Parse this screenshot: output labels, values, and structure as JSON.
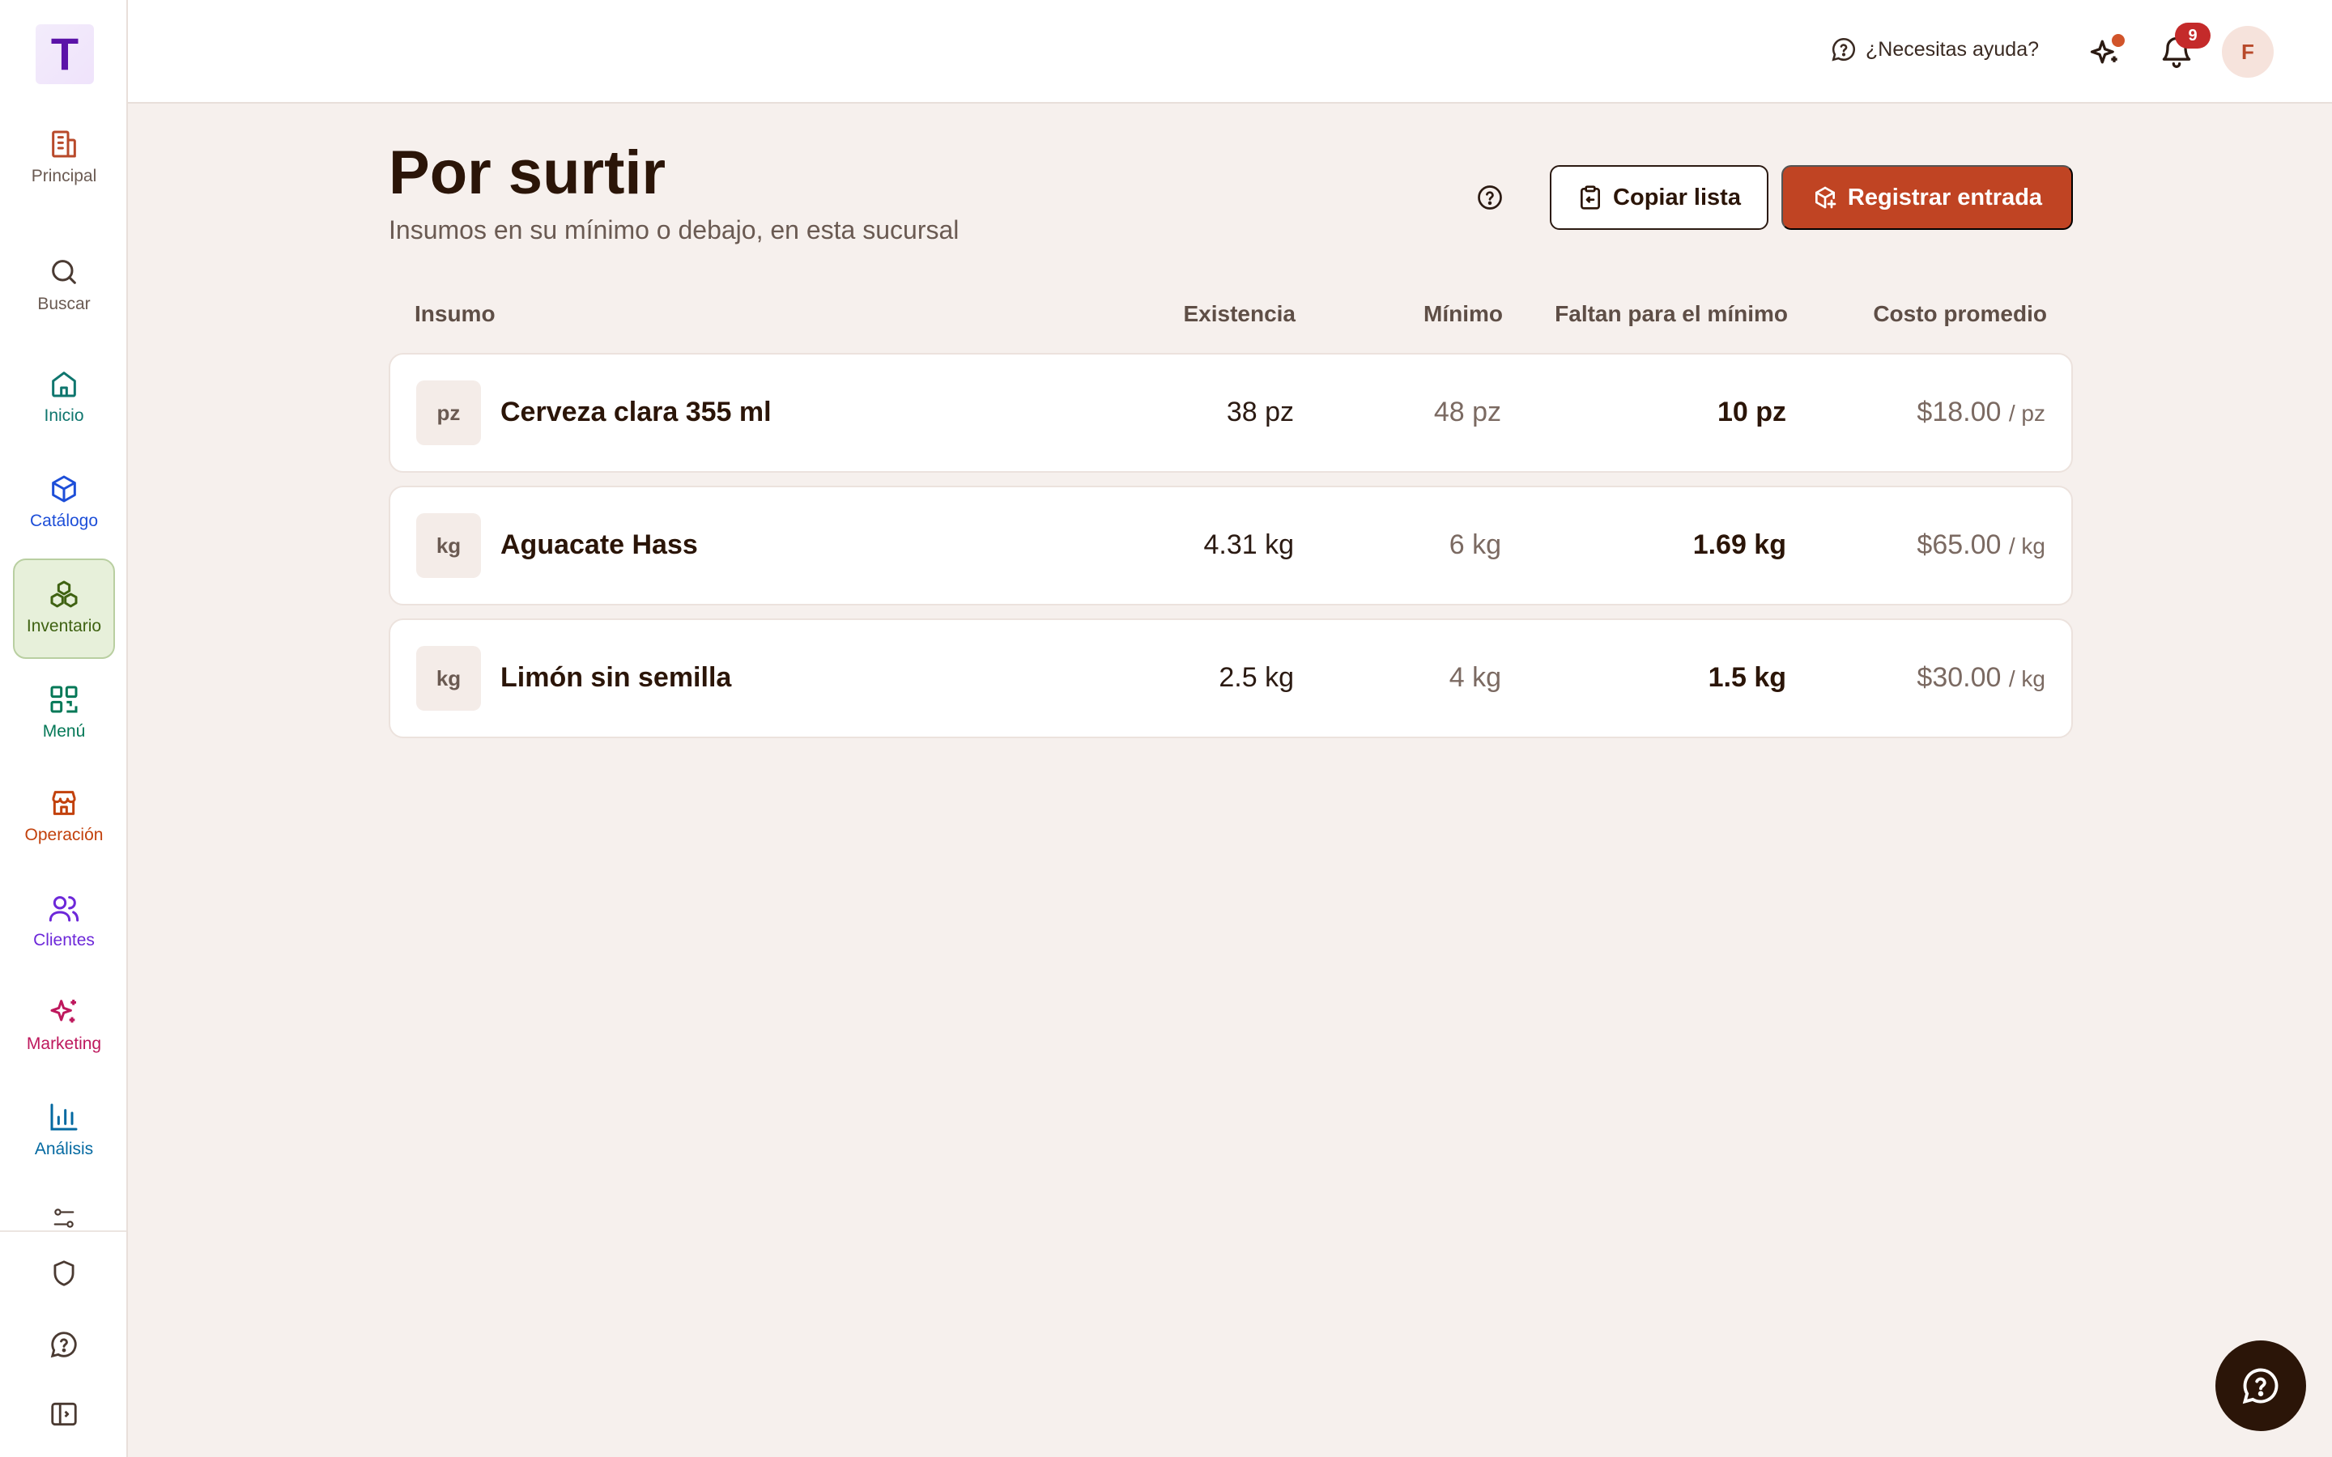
{
  "logo": {
    "letter": "T"
  },
  "sidebar": {
    "items": [
      {
        "label": "Principal",
        "color": "#b8492a",
        "icon": "building-icon"
      },
      {
        "label": "Buscar",
        "color": "#6a5a52",
        "icon": "search-icon"
      },
      {
        "label": "Inicio",
        "color": "#0f766e",
        "icon": "home-icon"
      },
      {
        "label": "Catálogo",
        "color": "#1d4ed8",
        "icon": "box-icon"
      },
      {
        "label": "Inventario",
        "color": "#3f6212",
        "icon": "boxes-icon",
        "active": true
      },
      {
        "label": "Menú",
        "color": "#047857",
        "icon": "qr-icon"
      },
      {
        "label": "Operación",
        "color": "#c2410c",
        "icon": "store-icon"
      },
      {
        "label": "Clientes",
        "color": "#6d28d9",
        "icon": "users-icon"
      },
      {
        "label": "Marketing",
        "color": "#be185d",
        "icon": "sparkles-icon"
      },
      {
        "label": "Análisis",
        "color": "#0369a1",
        "icon": "bar-chart-icon"
      }
    ]
  },
  "topbar": {
    "help_label": "¿Necesitas ayuda?",
    "notification_count": "9",
    "avatar_initial": "F"
  },
  "page": {
    "title": "Por surtir",
    "subtitle": "Insumos en su mínimo o debajo, en esta sucursal",
    "copy_button": "Copiar lista",
    "register_button": "Registrar entrada"
  },
  "table": {
    "headers": {
      "insumo": "Insumo",
      "existencia": "Existencia",
      "minimo": "Mínimo",
      "faltan": "Faltan para el mínimo",
      "costo": "Costo promedio"
    },
    "rows": [
      {
        "unit": "pz",
        "name": "Cerveza clara 355 ml",
        "existencia": "38 pz",
        "minimo": "48 pz",
        "faltan": "10 pz",
        "costo": "$18.00",
        "per": "/ pz"
      },
      {
        "unit": "kg",
        "name": "Aguacate Hass",
        "existencia": "4.31 kg",
        "minimo": "6 kg",
        "faltan": "1.69 kg",
        "costo": "$65.00",
        "per": "/ kg"
      },
      {
        "unit": "kg",
        "name": "Limón sin semilla",
        "existencia": "2.5 kg",
        "minimo": "4 kg",
        "faltan": "1.5 kg",
        "costo": "$30.00",
        "per": "/ kg"
      }
    ]
  },
  "colors": {
    "accent": "#c04423",
    "background": "#f6f0ed",
    "dark": "#2b1508"
  }
}
